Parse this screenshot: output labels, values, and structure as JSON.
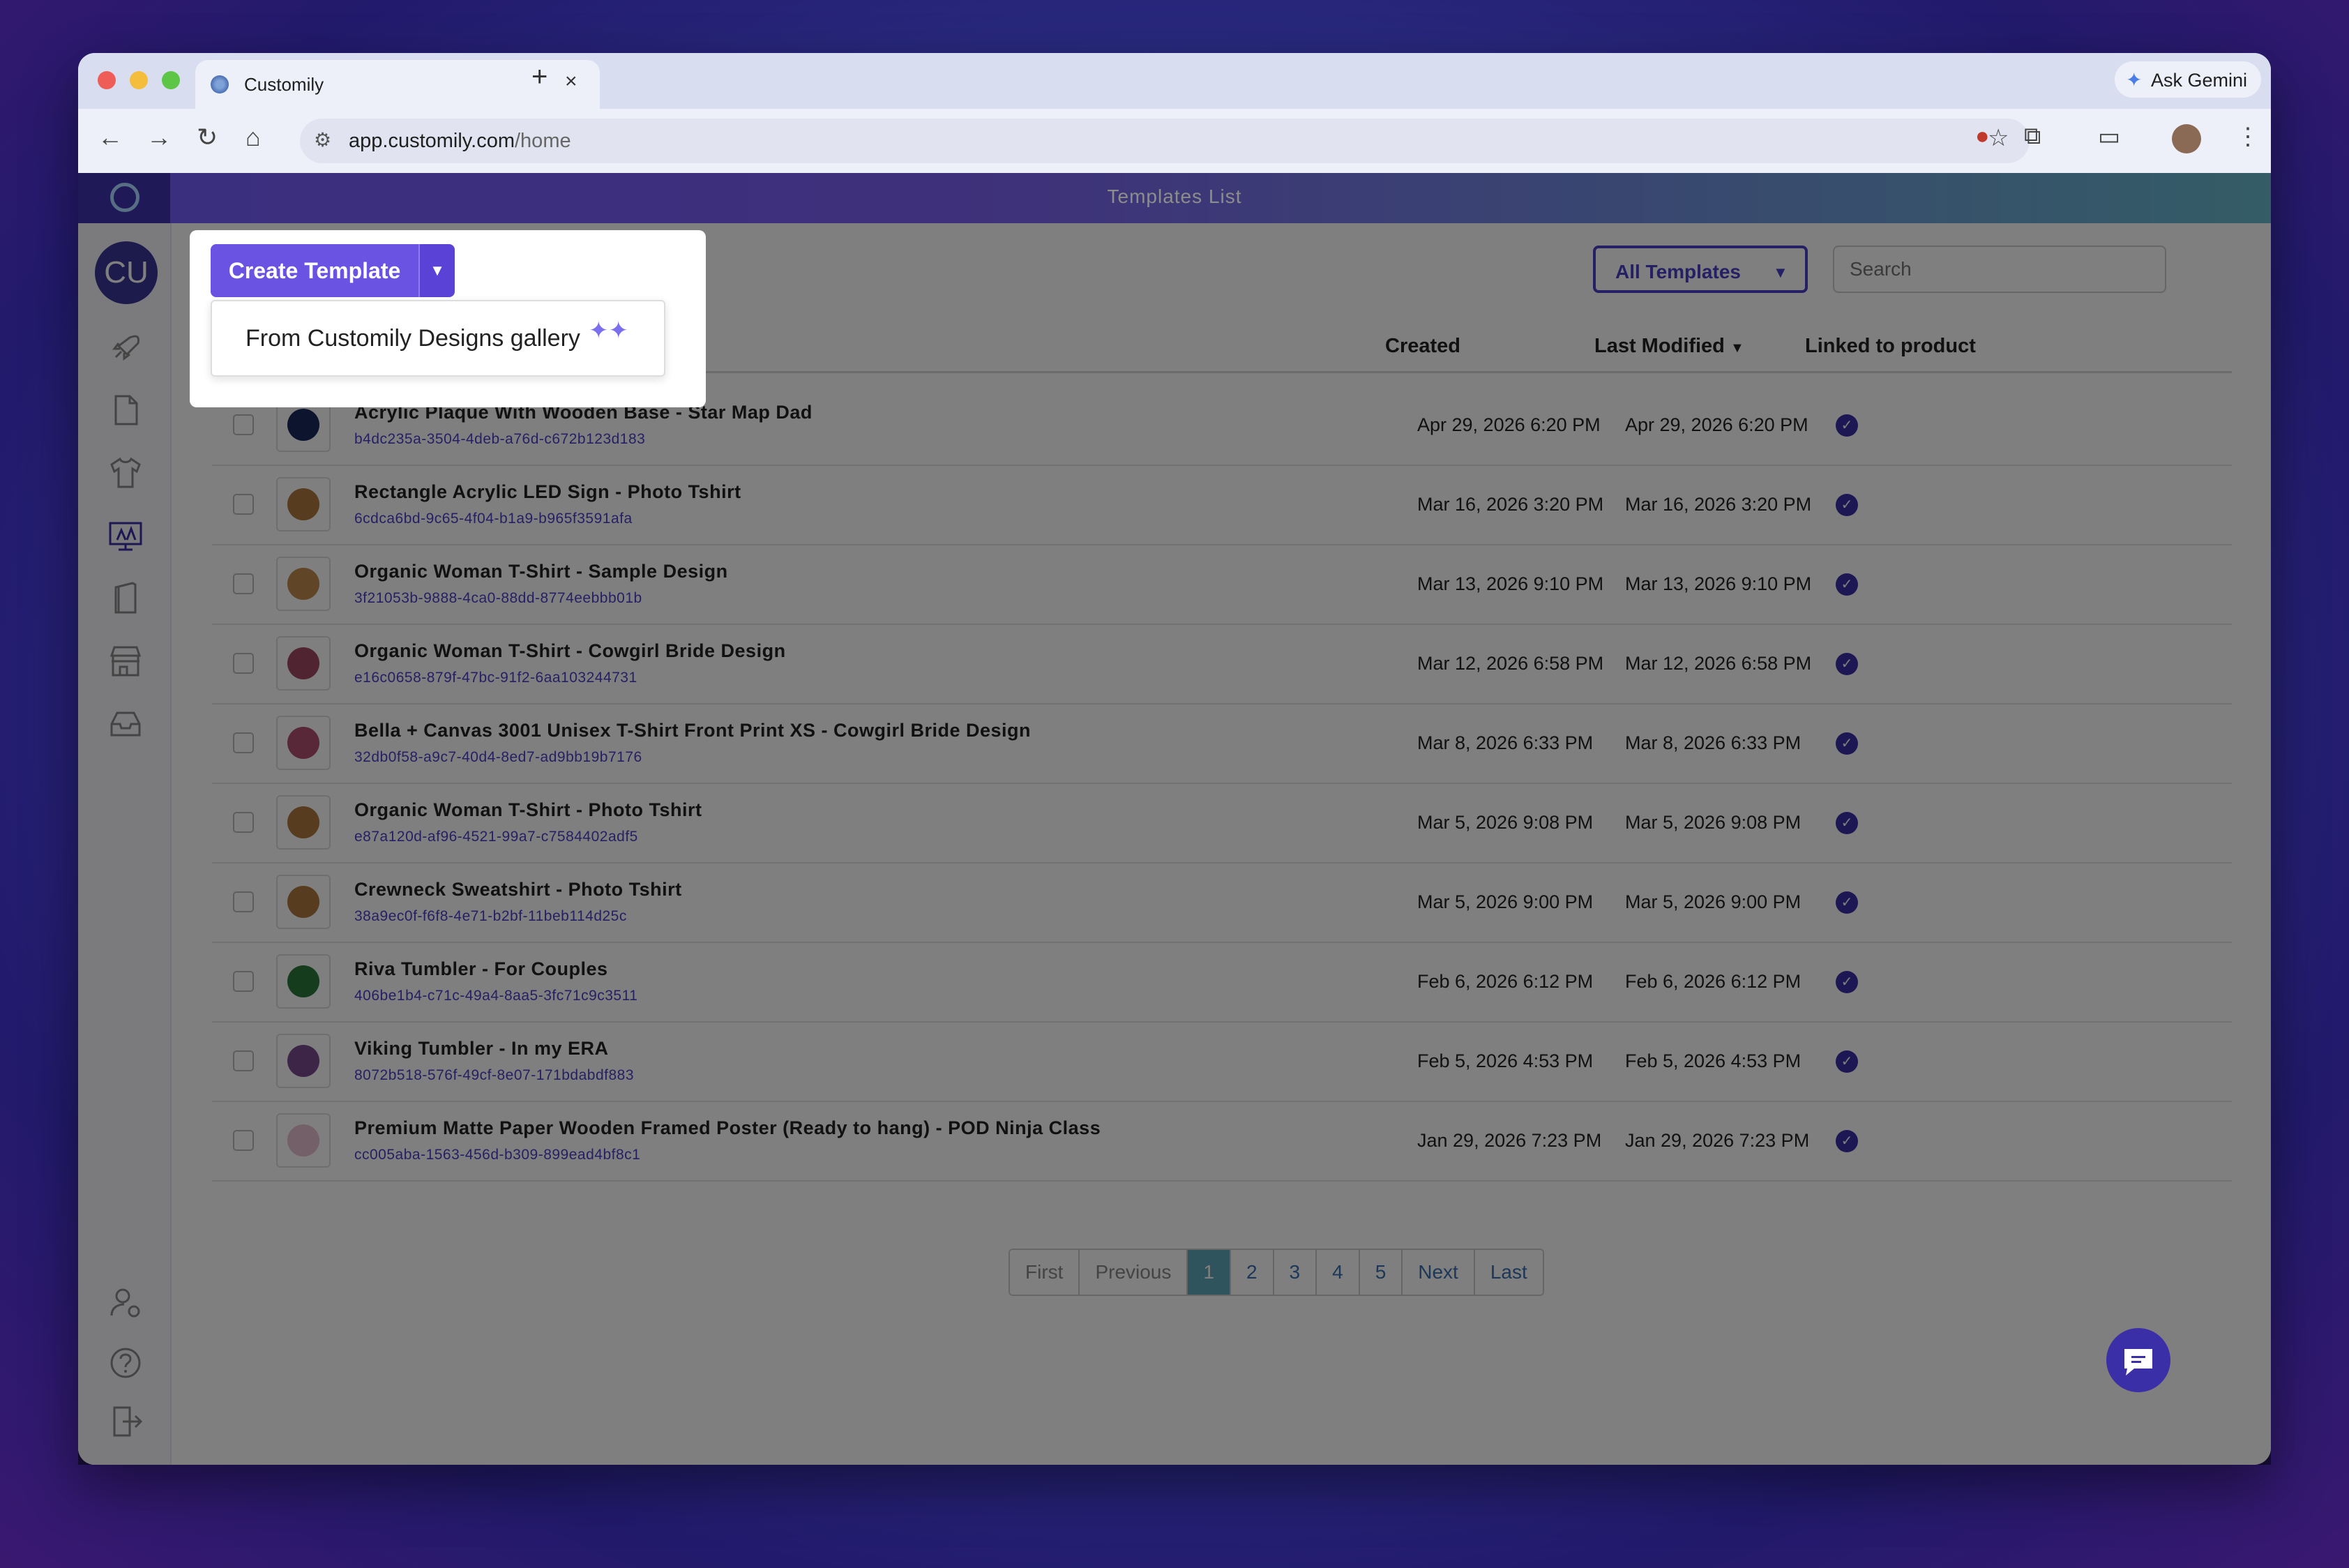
{
  "browser": {
    "tab_title": "Customily",
    "tab_close": "×",
    "new_tab": "+",
    "ask_gemini": "Ask Gemini",
    "url_host": "app.customily.com",
    "url_path": "/home"
  },
  "app": {
    "title": "Templates List",
    "avatar_initials": "CU"
  },
  "sidebar": {
    "items": [
      "rocket-icon",
      "document-icon",
      "tshirt-icon",
      "templates-icon",
      "book-icon",
      "store-icon",
      "inbox-icon"
    ],
    "bottom": [
      "user-settings-icon",
      "help-icon",
      "logout-icon"
    ]
  },
  "toolbar": {
    "create_label": "Create Template",
    "filter_label": "All Templates",
    "search_placeholder": "Search"
  },
  "dropdown": {
    "item_label": "From Customily Designs gallery"
  },
  "table": {
    "headers": {
      "created": "Created",
      "last_modified": "Last Modified",
      "linked": "Linked to product"
    },
    "rows": [
      {
        "name": "Acrylic Plaque With Wooden Base - Star Map Dad",
        "id": "b4dc235a-3504-4deb-a76d-c672b123d183",
        "created": "Apr 29, 2026 6:20 PM",
        "modified": "Apr 29, 2026 6:20 PM"
      },
      {
        "name": "Rectangle Acrylic LED Sign - Photo Tshirt",
        "id": "6cdca6bd-9c65-4f04-b1a9-b965f3591afa",
        "created": "Mar 16, 2026 3:20 PM",
        "modified": "Mar 16, 2026 3:20 PM"
      },
      {
        "name": "Organic Woman T-Shirt - Sample Design",
        "id": "3f21053b-9888-4ca0-88dd-8774eebbb01b",
        "created": "Mar 13, 2026 9:10 PM",
        "modified": "Mar 13, 2026 9:10 PM"
      },
      {
        "name": "Organic Woman T-Shirt - Cowgirl Bride Design",
        "id": "e16c0658-879f-47bc-91f2-6aa103244731",
        "created": "Mar 12, 2026 6:58 PM",
        "modified": "Mar 12, 2026 6:58 PM"
      },
      {
        "name": "Bella + Canvas 3001 Unisex T-Shirt Front Print XS - Cowgirl Bride Design",
        "id": "32db0f58-a9c7-40d4-8ed7-ad9bb19b7176",
        "created": "Mar 8, 2026 6:33 PM",
        "modified": "Mar 8, 2026 6:33 PM"
      },
      {
        "name": "Organic Woman T-Shirt - Photo Tshirt",
        "id": "e87a120d-af96-4521-99a7-c7584402adf5",
        "created": "Mar 5, 2026 9:08 PM",
        "modified": "Mar 5, 2026 9:08 PM"
      },
      {
        "name": "Crewneck Sweatshirt - Photo Tshirt",
        "id": "38a9ec0f-f6f8-4e71-b2bf-11beb114d25c",
        "created": "Mar 5, 2026 9:00 PM",
        "modified": "Mar 5, 2026 9:00 PM"
      },
      {
        "name": "Riva Tumbler - For Couples",
        "id": "406be1b4-c71c-49a4-8aa5-3fc71c9c3511",
        "created": "Feb 6, 2026 6:12 PM",
        "modified": "Feb 6, 2026 6:12 PM"
      },
      {
        "name": "Viking Tumbler - In my ERA",
        "id": "8072b518-576f-49cf-8e07-171bdabdf883",
        "created": "Feb 5, 2026 4:53 PM",
        "modified": "Feb 5, 2026 4:53 PM"
      },
      {
        "name": "Premium Matte Paper Wooden Framed Poster (Ready to hang) - POD Ninja Class",
        "id": "cc005aba-1563-456d-b309-899ead4bf8c1",
        "created": "Jan 29, 2026 7:23 PM",
        "modified": "Jan 29, 2026 7:23 PM"
      }
    ]
  },
  "pagination": {
    "first": "First",
    "previous": "Previous",
    "pages": [
      "1",
      "2",
      "3",
      "4",
      "5"
    ],
    "current": "1",
    "next": "Next",
    "last": "Last"
  },
  "colors": {
    "accent": "#6a52e3",
    "brand_dark": "#3b2fa8",
    "teal": "#5fa9ba"
  }
}
